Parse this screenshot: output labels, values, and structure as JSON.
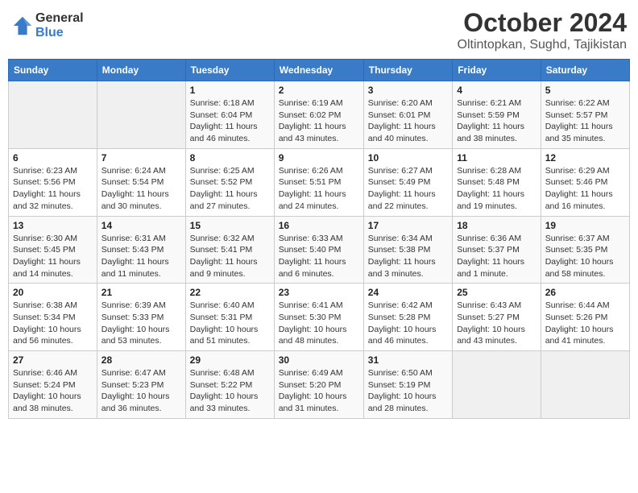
{
  "logo": {
    "general": "General",
    "blue": "Blue"
  },
  "title": {
    "month": "October 2024",
    "location": "Oltintopkan, Sughd, Tajikistan"
  },
  "headers": [
    "Sunday",
    "Monday",
    "Tuesday",
    "Wednesday",
    "Thursday",
    "Friday",
    "Saturday"
  ],
  "weeks": [
    [
      {
        "day": "",
        "info": ""
      },
      {
        "day": "",
        "info": ""
      },
      {
        "day": "1",
        "info": "Sunrise: 6:18 AM\nSunset: 6:04 PM\nDaylight: 11 hours and 46 minutes."
      },
      {
        "day": "2",
        "info": "Sunrise: 6:19 AM\nSunset: 6:02 PM\nDaylight: 11 hours and 43 minutes."
      },
      {
        "day": "3",
        "info": "Sunrise: 6:20 AM\nSunset: 6:01 PM\nDaylight: 11 hours and 40 minutes."
      },
      {
        "day": "4",
        "info": "Sunrise: 6:21 AM\nSunset: 5:59 PM\nDaylight: 11 hours and 38 minutes."
      },
      {
        "day": "5",
        "info": "Sunrise: 6:22 AM\nSunset: 5:57 PM\nDaylight: 11 hours and 35 minutes."
      }
    ],
    [
      {
        "day": "6",
        "info": "Sunrise: 6:23 AM\nSunset: 5:56 PM\nDaylight: 11 hours and 32 minutes."
      },
      {
        "day": "7",
        "info": "Sunrise: 6:24 AM\nSunset: 5:54 PM\nDaylight: 11 hours and 30 minutes."
      },
      {
        "day": "8",
        "info": "Sunrise: 6:25 AM\nSunset: 5:52 PM\nDaylight: 11 hours and 27 minutes."
      },
      {
        "day": "9",
        "info": "Sunrise: 6:26 AM\nSunset: 5:51 PM\nDaylight: 11 hours and 24 minutes."
      },
      {
        "day": "10",
        "info": "Sunrise: 6:27 AM\nSunset: 5:49 PM\nDaylight: 11 hours and 22 minutes."
      },
      {
        "day": "11",
        "info": "Sunrise: 6:28 AM\nSunset: 5:48 PM\nDaylight: 11 hours and 19 minutes."
      },
      {
        "day": "12",
        "info": "Sunrise: 6:29 AM\nSunset: 5:46 PM\nDaylight: 11 hours and 16 minutes."
      }
    ],
    [
      {
        "day": "13",
        "info": "Sunrise: 6:30 AM\nSunset: 5:45 PM\nDaylight: 11 hours and 14 minutes."
      },
      {
        "day": "14",
        "info": "Sunrise: 6:31 AM\nSunset: 5:43 PM\nDaylight: 11 hours and 11 minutes."
      },
      {
        "day": "15",
        "info": "Sunrise: 6:32 AM\nSunset: 5:41 PM\nDaylight: 11 hours and 9 minutes."
      },
      {
        "day": "16",
        "info": "Sunrise: 6:33 AM\nSunset: 5:40 PM\nDaylight: 11 hours and 6 minutes."
      },
      {
        "day": "17",
        "info": "Sunrise: 6:34 AM\nSunset: 5:38 PM\nDaylight: 11 hours and 3 minutes."
      },
      {
        "day": "18",
        "info": "Sunrise: 6:36 AM\nSunset: 5:37 PM\nDaylight: 11 hours and 1 minute."
      },
      {
        "day": "19",
        "info": "Sunrise: 6:37 AM\nSunset: 5:35 PM\nDaylight: 10 hours and 58 minutes."
      }
    ],
    [
      {
        "day": "20",
        "info": "Sunrise: 6:38 AM\nSunset: 5:34 PM\nDaylight: 10 hours and 56 minutes."
      },
      {
        "day": "21",
        "info": "Sunrise: 6:39 AM\nSunset: 5:33 PM\nDaylight: 10 hours and 53 minutes."
      },
      {
        "day": "22",
        "info": "Sunrise: 6:40 AM\nSunset: 5:31 PM\nDaylight: 10 hours and 51 minutes."
      },
      {
        "day": "23",
        "info": "Sunrise: 6:41 AM\nSunset: 5:30 PM\nDaylight: 10 hours and 48 minutes."
      },
      {
        "day": "24",
        "info": "Sunrise: 6:42 AM\nSunset: 5:28 PM\nDaylight: 10 hours and 46 minutes."
      },
      {
        "day": "25",
        "info": "Sunrise: 6:43 AM\nSunset: 5:27 PM\nDaylight: 10 hours and 43 minutes."
      },
      {
        "day": "26",
        "info": "Sunrise: 6:44 AM\nSunset: 5:26 PM\nDaylight: 10 hours and 41 minutes."
      }
    ],
    [
      {
        "day": "27",
        "info": "Sunrise: 6:46 AM\nSunset: 5:24 PM\nDaylight: 10 hours and 38 minutes."
      },
      {
        "day": "28",
        "info": "Sunrise: 6:47 AM\nSunset: 5:23 PM\nDaylight: 10 hours and 36 minutes."
      },
      {
        "day": "29",
        "info": "Sunrise: 6:48 AM\nSunset: 5:22 PM\nDaylight: 10 hours and 33 minutes."
      },
      {
        "day": "30",
        "info": "Sunrise: 6:49 AM\nSunset: 5:20 PM\nDaylight: 10 hours and 31 minutes."
      },
      {
        "day": "31",
        "info": "Sunrise: 6:50 AM\nSunset: 5:19 PM\nDaylight: 10 hours and 28 minutes."
      },
      {
        "day": "",
        "info": ""
      },
      {
        "day": "",
        "info": ""
      }
    ]
  ]
}
